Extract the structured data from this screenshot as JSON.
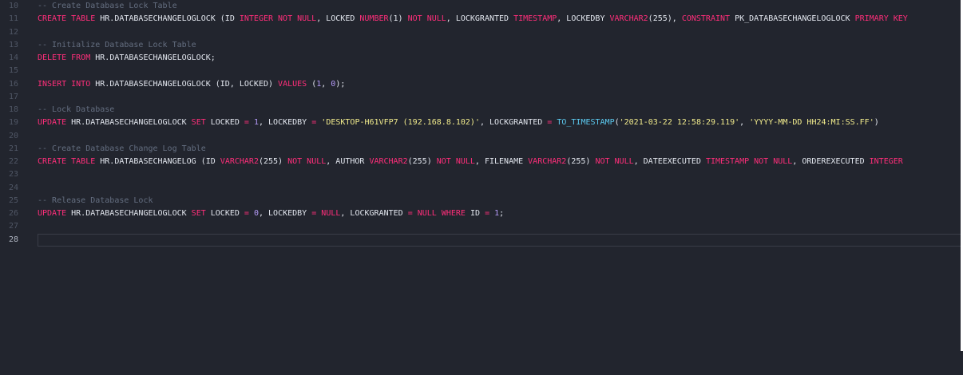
{
  "editor": {
    "line_numbers": [
      "10",
      "11",
      "12",
      "13",
      "14",
      "15",
      "16",
      "17",
      "18",
      "19",
      "20",
      "21",
      "22",
      "23",
      "24",
      "25",
      "26",
      "27",
      "28"
    ],
    "active_line": "28",
    "lines": [
      [
        {
          "t": "-- Create Database Lock Table",
          "c": "cm"
        }
      ],
      [
        {
          "t": "CREATE TABLE",
          "c": "kw"
        },
        {
          "t": " HR.DATABASECHANGELOGLOCK (ID ",
          "c": "pl"
        },
        {
          "t": "INTEGER NOT NULL",
          "c": "kw"
        },
        {
          "t": ", LOCKED ",
          "c": "pl"
        },
        {
          "t": "NUMBER",
          "c": "kw"
        },
        {
          "t": "(1) ",
          "c": "pl"
        },
        {
          "t": "NOT NULL",
          "c": "kw"
        },
        {
          "t": ", LOCKGRANTED ",
          "c": "pl"
        },
        {
          "t": "TIMESTAMP",
          "c": "kw"
        },
        {
          "t": ", LOCKEDBY ",
          "c": "pl"
        },
        {
          "t": "VARCHAR2",
          "c": "kw"
        },
        {
          "t": "(255), ",
          "c": "pl"
        },
        {
          "t": "CONSTRAINT",
          "c": "kw"
        },
        {
          "t": " PK_DATABASECHANGELOGLOCK ",
          "c": "pl"
        },
        {
          "t": "PRIMARY KEY",
          "c": "kw"
        }
      ],
      [],
      [
        {
          "t": "-- Initialize Database Lock Table",
          "c": "cm"
        }
      ],
      [
        {
          "t": "DELETE FROM",
          "c": "kw"
        },
        {
          "t": " HR.DATABASECHANGELOGLOCK;",
          "c": "pl"
        }
      ],
      [],
      [
        {
          "t": "INSERT INTO",
          "c": "kw"
        },
        {
          "t": " HR.DATABASECHANGELOGLOCK (ID, LOCKED) ",
          "c": "pl"
        },
        {
          "t": "VALUES",
          "c": "kw"
        },
        {
          "t": " (",
          "c": "pl"
        },
        {
          "t": "1",
          "c": "nm"
        },
        {
          "t": ", ",
          "c": "pl"
        },
        {
          "t": "0",
          "c": "nm"
        },
        {
          "t": ");",
          "c": "pl"
        }
      ],
      [],
      [
        {
          "t": "-- Lock Database",
          "c": "cm"
        }
      ],
      [
        {
          "t": "UPDATE",
          "c": "kw"
        },
        {
          "t": " HR.DATABASECHANGELOGLOCK ",
          "c": "pl"
        },
        {
          "t": "SET",
          "c": "kw"
        },
        {
          "t": " LOCKED ",
          "c": "pl"
        },
        {
          "t": "=",
          "c": "kw"
        },
        {
          "t": " ",
          "c": "pl"
        },
        {
          "t": "1",
          "c": "nm"
        },
        {
          "t": ", LOCKEDBY ",
          "c": "pl"
        },
        {
          "t": "=",
          "c": "kw"
        },
        {
          "t": " ",
          "c": "pl"
        },
        {
          "t": "'DESKTOP-H61VFP7 (192.168.8.102)'",
          "c": "st"
        },
        {
          "t": ", LOCKGRANTED ",
          "c": "pl"
        },
        {
          "t": "=",
          "c": "kw"
        },
        {
          "t": " ",
          "c": "pl"
        },
        {
          "t": "TO_TIMESTAMP",
          "c": "fn"
        },
        {
          "t": "(",
          "c": "pl"
        },
        {
          "t": "'2021-03-22 12:58:29.119'",
          "c": "st"
        },
        {
          "t": ", ",
          "c": "pl"
        },
        {
          "t": "'YYYY-MM-DD HH24:MI:SS.FF'",
          "c": "st"
        },
        {
          "t": ")",
          "c": "pl"
        }
      ],
      [],
      [
        {
          "t": "-- Create Database Change Log Table",
          "c": "cm"
        }
      ],
      [
        {
          "t": "CREATE TABLE",
          "c": "kw"
        },
        {
          "t": " HR.DATABASECHANGELOG (ID ",
          "c": "pl"
        },
        {
          "t": "VARCHAR2",
          "c": "kw"
        },
        {
          "t": "(255) ",
          "c": "pl"
        },
        {
          "t": "NOT NULL",
          "c": "kw"
        },
        {
          "t": ", AUTHOR ",
          "c": "pl"
        },
        {
          "t": "VARCHAR2",
          "c": "kw"
        },
        {
          "t": "(255) ",
          "c": "pl"
        },
        {
          "t": "NOT NULL",
          "c": "kw"
        },
        {
          "t": ", FILENAME ",
          "c": "pl"
        },
        {
          "t": "VARCHAR2",
          "c": "kw"
        },
        {
          "t": "(255) ",
          "c": "pl"
        },
        {
          "t": "NOT NULL",
          "c": "kw"
        },
        {
          "t": ", DATEEXECUTED ",
          "c": "pl"
        },
        {
          "t": "TIMESTAMP NOT NULL",
          "c": "kw"
        },
        {
          "t": ", ORDEREXECUTED ",
          "c": "pl"
        },
        {
          "t": "INTEGER",
          "c": "kw"
        }
      ],
      [],
      [],
      [
        {
          "t": "-- Release Database Lock",
          "c": "cm"
        }
      ],
      [
        {
          "t": "UPDATE",
          "c": "kw"
        },
        {
          "t": " HR.DATABASECHANGELOGLOCK ",
          "c": "pl"
        },
        {
          "t": "SET",
          "c": "kw"
        },
        {
          "t": " LOCKED ",
          "c": "pl"
        },
        {
          "t": "=",
          "c": "kw"
        },
        {
          "t": " ",
          "c": "pl"
        },
        {
          "t": "0",
          "c": "nm"
        },
        {
          "t": ", LOCKEDBY ",
          "c": "pl"
        },
        {
          "t": "=",
          "c": "kw"
        },
        {
          "t": " ",
          "c": "pl"
        },
        {
          "t": "NULL",
          "c": "kw"
        },
        {
          "t": ", LOCKGRANTED ",
          "c": "pl"
        },
        {
          "t": "=",
          "c": "kw"
        },
        {
          "t": " ",
          "c": "pl"
        },
        {
          "t": "NULL WHERE",
          "c": "kw"
        },
        {
          "t": " ID ",
          "c": "pl"
        },
        {
          "t": "=",
          "c": "kw"
        },
        {
          "t": " ",
          "c": "pl"
        },
        {
          "t": "1",
          "c": "nm"
        },
        {
          "t": ";",
          "c": "pl"
        }
      ],
      [],
      []
    ]
  },
  "colors": {
    "background": "#22252e",
    "keyword": "#ff2e7a",
    "string": "#f1eb8c",
    "function": "#5ccaf0",
    "number": "#b49af7",
    "comment": "#646e80",
    "line_number": "#4f5665"
  }
}
